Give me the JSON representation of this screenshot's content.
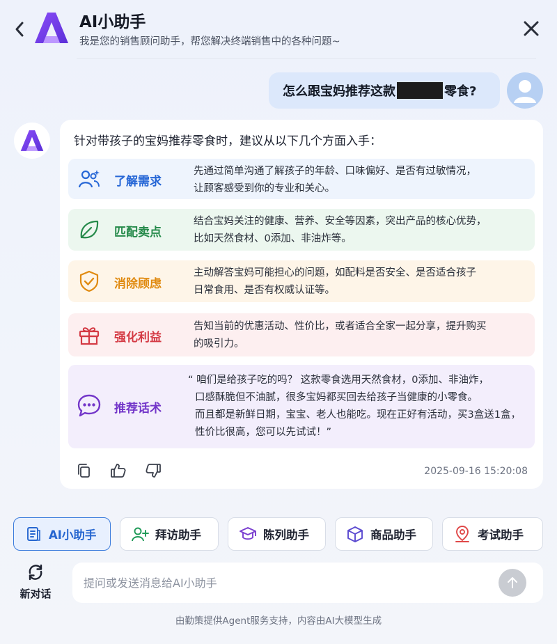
{
  "header": {
    "title": "AI小助手",
    "subtitle": "我是您的销售顾问助手，帮您解决终端销售中的各种问题~"
  },
  "user_message": {
    "before": "怎么跟宝妈推荐这款",
    "after": "零食?"
  },
  "assistant": {
    "intro": "针对带孩子的宝妈推荐零食时，建议从以下几个方面入手：",
    "items": [
      {
        "title": "了解需求",
        "lines": [
          "先通过简单沟通了解孩子的年龄、口味偏好、是否有过敏情况，",
          "让顾客感受到你的专业和关心。"
        ]
      },
      {
        "title": "匹配卖点",
        "lines": [
          "结合宝妈关注的健康、营养、安全等因素，突出产品的核心优势，",
          "比如天然食材、0添加、非油炸等。"
        ]
      },
      {
        "title": "消除顾虑",
        "lines": [
          "主动解答宝妈可能担心的问题，如配料是否安全、是否适合孩子",
          "日常食用、是否有权威认证等。"
        ]
      },
      {
        "title": "强化利益",
        "lines": [
          "告知当前的优惠活动、性价比，或者适合全家一起分享，提升购买",
          "的吸引力。"
        ]
      },
      {
        "title": "推荐话术",
        "lines": [
          "“ 咱们是给孩子吃的吗？ 这款零食选用天然食材，0添加、非油炸，",
          "口感酥脆但不油腻，很多宝妈都买回去给孩子当健康的小零食。",
          "而且都是新鲜日期，宝宝、老人也能吃。现在正好有活动，买3盒送1盒，",
          "性价比很高，您可以先试试！”"
        ]
      }
    ],
    "timestamp": "2025-09-16 15:20:08"
  },
  "tools": [
    "AI小助手",
    "拜访助手",
    "陈列助手",
    "商品助手",
    "考试助手"
  ],
  "new_chat_label": "新对话",
  "input_placeholder": "提问或发送消息给AI小助手",
  "footer": "由勤策提供Agent服务支持，内容由AI大模型生成",
  "colors": {
    "accent_blue": "#2767d6",
    "green": "#258a4a",
    "orange": "#e08a10",
    "red": "#d43a44",
    "purple": "#7336c9",
    "logo_gradient": [
      "#6a3cf0",
      "#a95bf5"
    ]
  },
  "icons": {
    "back": "chevron-left-icon",
    "close": "close-icon",
    "items": [
      "users-icon",
      "leaf-icon",
      "shield-check-icon",
      "gift-icon",
      "chat-bubble-icon"
    ],
    "actions": [
      "copy-icon",
      "thumbs-up-icon",
      "thumbs-down-icon"
    ],
    "tools": [
      "document-icon",
      "user-plus-icon",
      "graduation-cap-icon",
      "box-icon",
      "map-pin-icon"
    ],
    "new_chat": "refresh-icon",
    "send": "arrow-up-icon"
  }
}
